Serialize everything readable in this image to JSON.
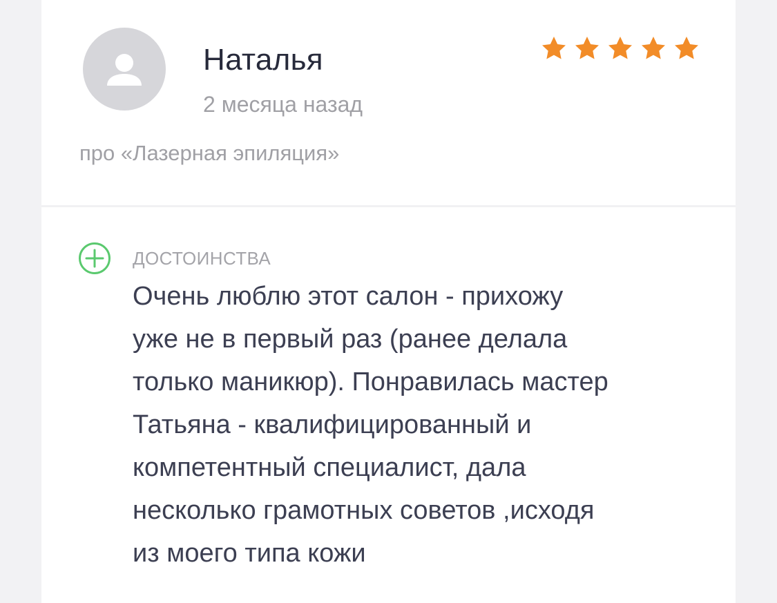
{
  "review": {
    "author_name": "Наталья",
    "date": "2 месяца назад",
    "about": "про «Лазерная эпиляция»",
    "rating": {
      "value": 5,
      "max": 5,
      "color": "#f28c28"
    },
    "avatar_icon": "user-icon",
    "pros": {
      "icon": "plus-circle-icon",
      "icon_color": "#5ac96e",
      "title": "ДОСТОИНСТВА",
      "lines": [
        "Очень люблю этот салон - прихожу",
        "уже не в первый раз (ранее делала",
        "только маникюр). Понравилась мастер",
        "Татьяна - квалифицированный и",
        "компетентный специалист, дала",
        "несколько грамотных советов ,исходя",
        "из моего типа кожи"
      ]
    }
  }
}
